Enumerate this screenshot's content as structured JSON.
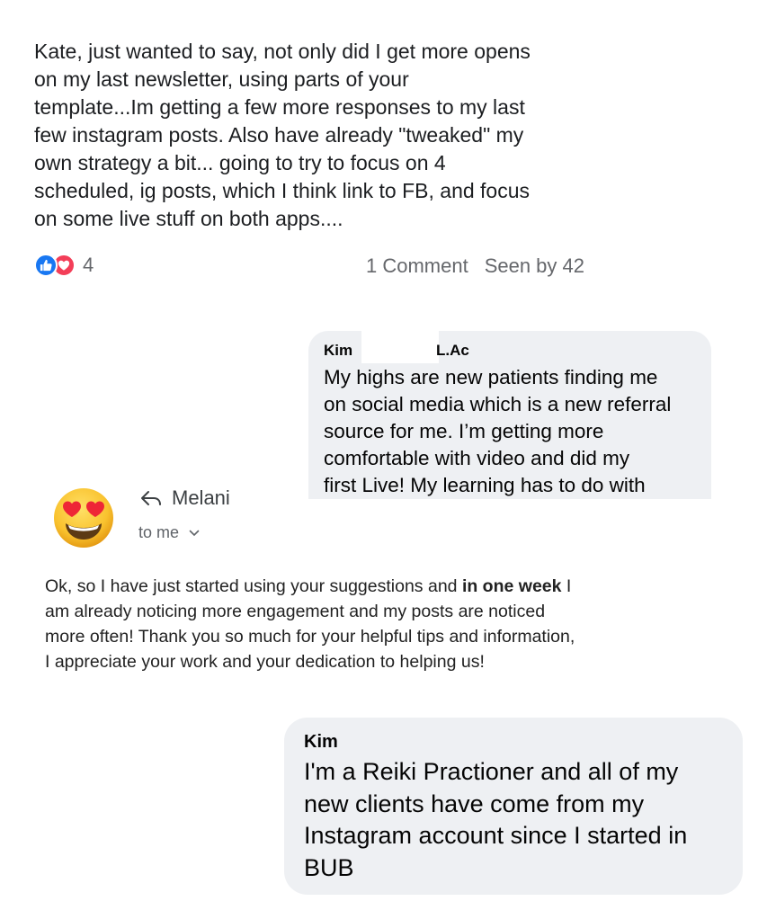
{
  "post": {
    "text": "Kate, just wanted to say, not only did I get more opens\non my last newsletter, using parts of your\ntemplate...Im getting a few more responses to my last\nfew instagram posts.  Also have already \"tweaked\" my\nown strategy a bit... going to try to focus on 4\nscheduled, ig posts, which I think link to FB, and focus\non some live stuff on both apps....",
    "reaction_count": "4",
    "comments": "1 Comment",
    "seen_by": "Seen by 42",
    "colors": {
      "like": "#1877f2",
      "love": "#f33e58"
    }
  },
  "comment1": {
    "author_first": "Kim",
    "author_suffix": "L.Ac",
    "text": "My highs are new patients finding me\non social media which is a new referral\nsource for me. I’m getting more\ncomfortable with video and did my\nfirst Live! My learning has to do with"
  },
  "email": {
    "avatar_icon": "heart-eyes-emoji-icon",
    "reply_icon": "reply-arrow-icon",
    "sender": "Melani",
    "recipient": "to me",
    "body_part1": "Ok, so I have just started using your suggestions and ",
    "body_bold": "in one week",
    "body_part2": " I am already noticing more engagement and my posts are noticed more often! Thank you so much for your helpful tips and information, I appreciate your work and your dedication to helping us!"
  },
  "comment2": {
    "author": "Kim",
    "text": "I'm a Reiki Practioner and all of my\nnew clients have come from my\nInstagram account since I started in\nBUB"
  }
}
